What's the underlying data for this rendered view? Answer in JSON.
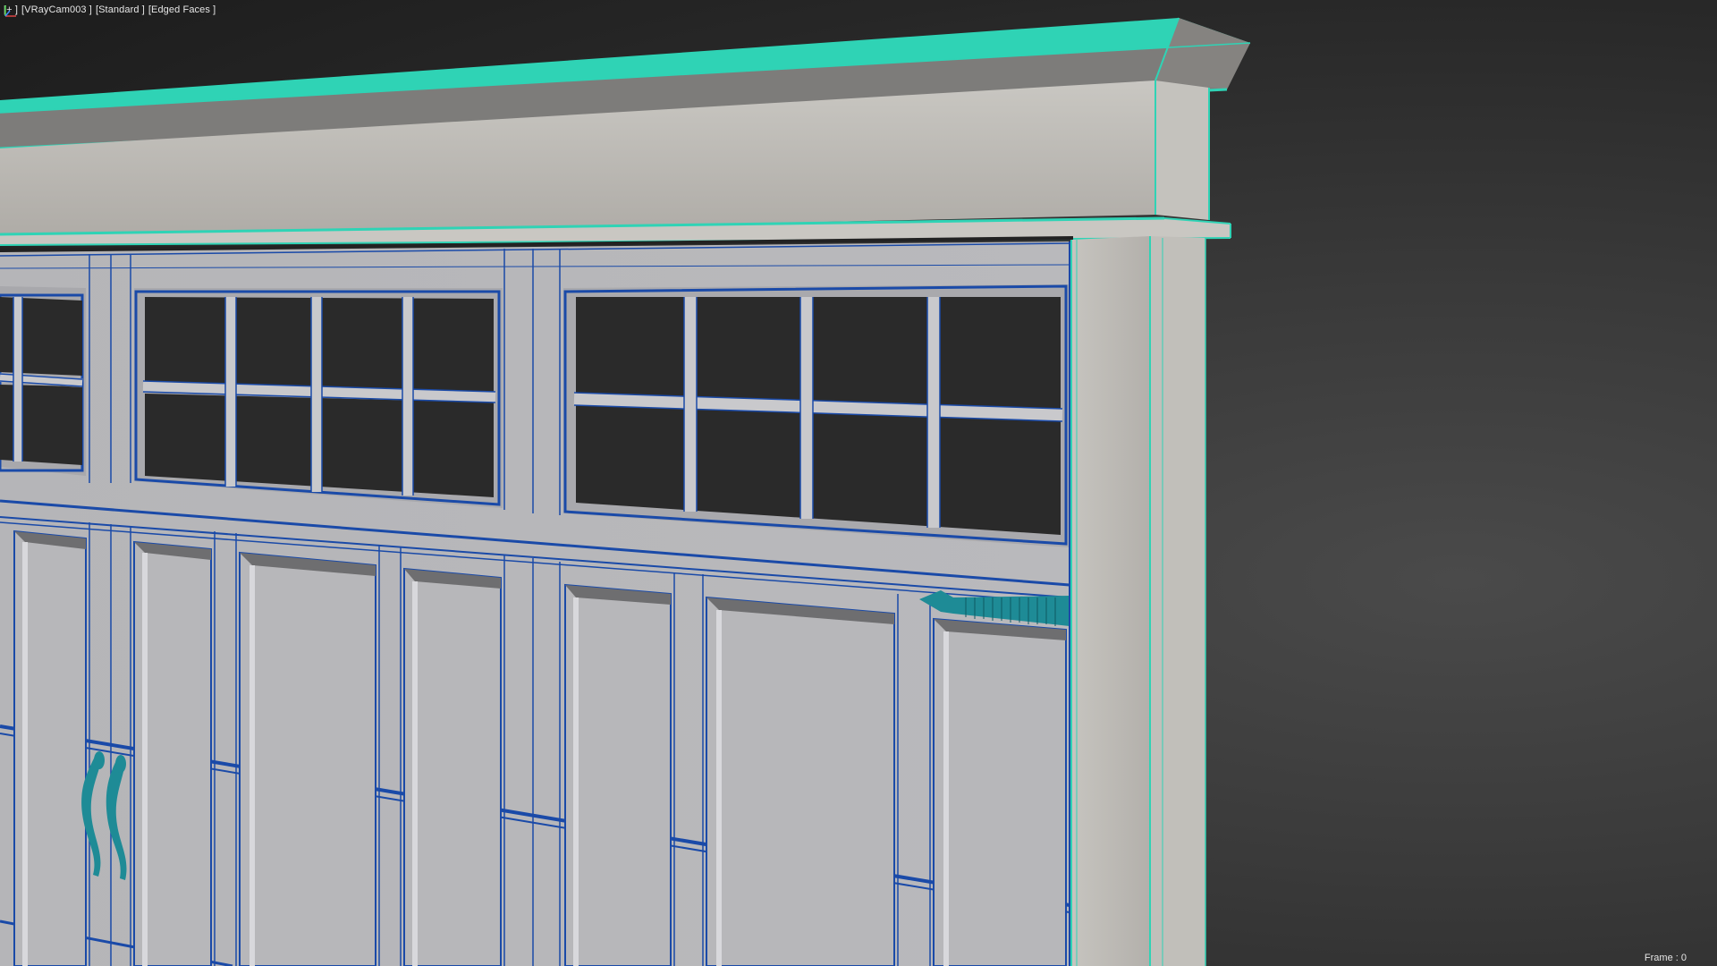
{
  "viewport": {
    "plus_menu": "[+ ]",
    "camera_menu": "[VRayCam003 ]",
    "shading_menu": "[Standard ]",
    "edged_faces_menu": "[Edged Faces ]",
    "frame_label": "Frame : 0"
  },
  "colors": {
    "background_dark": "#1c1c1c",
    "background_light": "#4a4a4a",
    "wall_gray": "#bdbdbd",
    "wall_light": "#c8c6c0",
    "door_panel": "#b6b6b8",
    "wire_blue": "#1a4aa8",
    "wire_cyan": "#2fd3b5",
    "handle_teal": "#1e8b96"
  },
  "icons": [
    "axis-gizmo-icon",
    "door-handle-icon",
    "hinge-icon"
  ]
}
